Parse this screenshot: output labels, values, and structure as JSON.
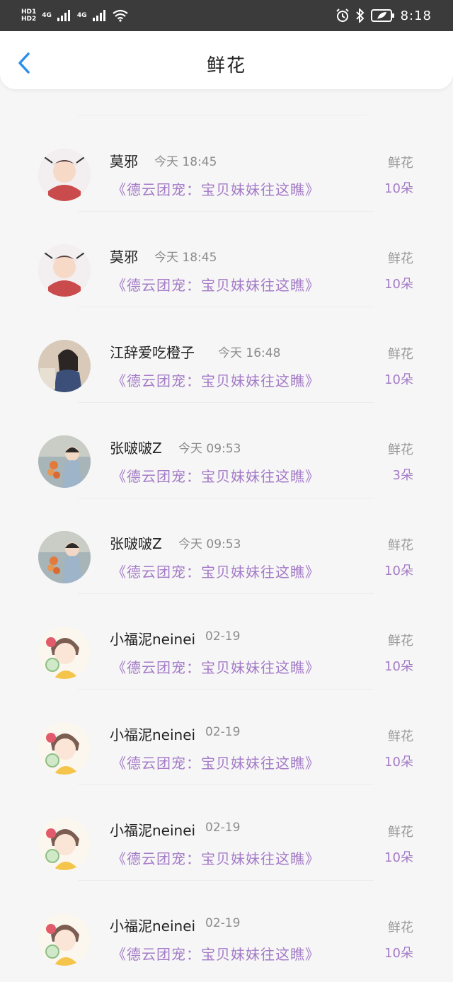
{
  "status_bar": {
    "sim1": "HD1",
    "sim2": "HD2",
    "net1": "4G",
    "net2": "4G",
    "time": "8:18"
  },
  "header": {
    "title": "鲜花"
  },
  "items": [
    {
      "name": "莫邪",
      "time": "今天 18:45",
      "book": "《德云团宠：宝贝妹妹往这瞧》",
      "gift": "鲜花",
      "count": "10朵"
    },
    {
      "name": "莫邪",
      "time": "今天 18:45",
      "book": "《德云团宠：宝贝妹妹往这瞧》",
      "gift": "鲜花",
      "count": "10朵"
    },
    {
      "name": "江辞爱吃橙子",
      "time": "今天 16:48",
      "book": "《德云团宠：宝贝妹妹往这瞧》",
      "gift": "鲜花",
      "count": "10朵"
    },
    {
      "name": "张啵啵Z",
      "time": "今天 09:53",
      "book": "《德云团宠：宝贝妹妹往这瞧》",
      "gift": "鲜花",
      "count": "3朵"
    },
    {
      "name": "张啵啵Z",
      "time": "今天 09:53",
      "book": "《德云团宠：宝贝妹妹往这瞧》",
      "gift": "鲜花",
      "count": "10朵"
    },
    {
      "name": "小福泥neinei",
      "time": "02-19",
      "book": "《德云团宠：宝贝妹妹往这瞧》",
      "gift": "鲜花",
      "count": "10朵"
    },
    {
      "name": "小福泥neinei",
      "time": "02-19",
      "book": "《德云团宠：宝贝妹妹往这瞧》",
      "gift": "鲜花",
      "count": "10朵"
    },
    {
      "name": "小福泥neinei",
      "time": "02-19",
      "book": "《德云团宠：宝贝妹妹往这瞧》",
      "gift": "鲜花",
      "count": "10朵"
    },
    {
      "name": "小福泥neinei",
      "time": "02-19",
      "book": "《德云团宠：宝贝妹妹往这瞧》",
      "gift": "鲜花",
      "count": "10朵"
    }
  ],
  "colors": {
    "accent": "#a47bc7",
    "back": "#2b8fe8"
  }
}
